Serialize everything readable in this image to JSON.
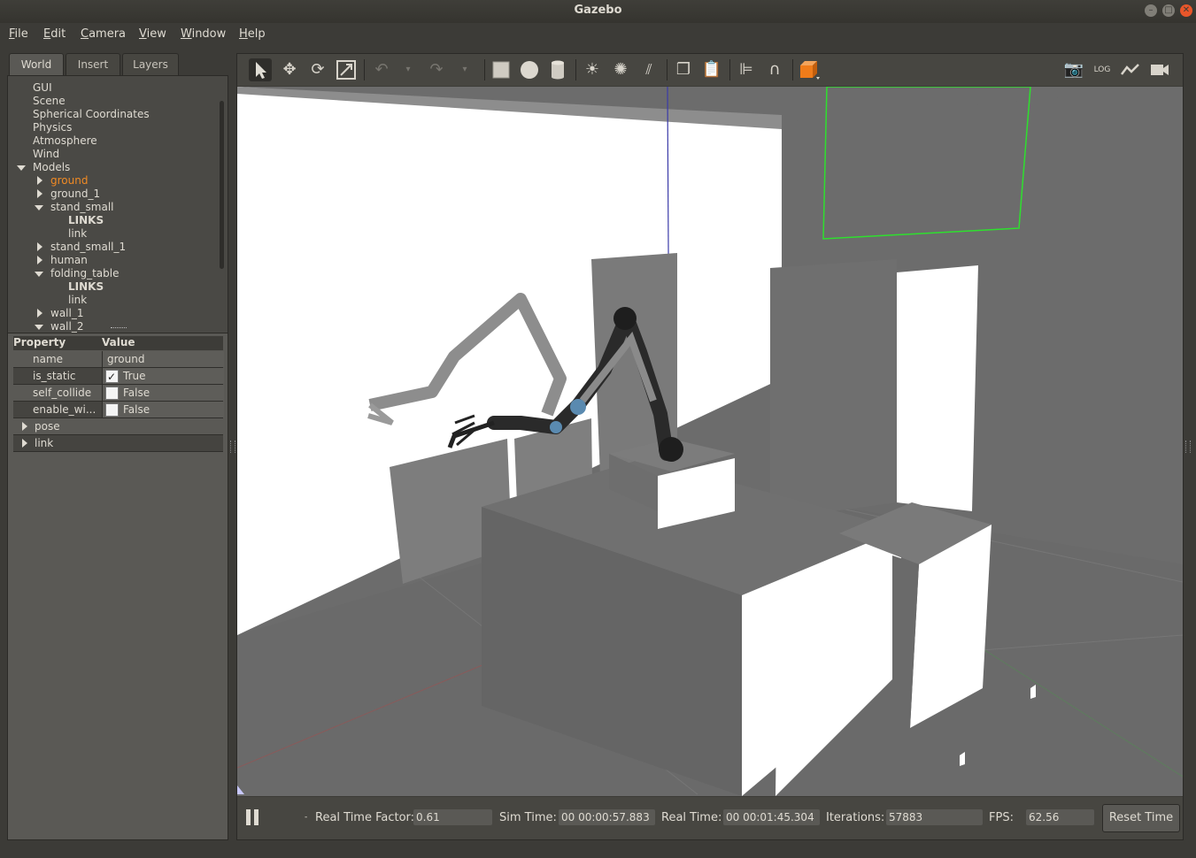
{
  "window": {
    "title": "Gazebo"
  },
  "menu": [
    "File",
    "Edit",
    "Camera",
    "View",
    "Window",
    "Help"
  ],
  "tabs": [
    "World",
    "Insert",
    "Layers"
  ],
  "tree": [
    {
      "label": "GUI",
      "indent": 0,
      "arrow": "none"
    },
    {
      "label": "Scene",
      "indent": 0,
      "arrow": "none"
    },
    {
      "label": "Spherical Coordinates",
      "indent": 0,
      "arrow": "none"
    },
    {
      "label": "Physics",
      "indent": 0,
      "arrow": "none"
    },
    {
      "label": "Atmosphere",
      "indent": 0,
      "arrow": "none"
    },
    {
      "label": "Wind",
      "indent": 0,
      "arrow": "none"
    },
    {
      "label": "Models",
      "indent": 0,
      "arrow": "down"
    },
    {
      "label": "ground",
      "indent": 1,
      "arrow": "right",
      "selected": true
    },
    {
      "label": "ground_1",
      "indent": 1,
      "arrow": "right"
    },
    {
      "label": "stand_small",
      "indent": 1,
      "arrow": "down"
    },
    {
      "label": "LINKS",
      "indent": 2,
      "arrow": "none",
      "bold": true
    },
    {
      "label": "link",
      "indent": 2,
      "arrow": "none"
    },
    {
      "label": "stand_small_1",
      "indent": 1,
      "arrow": "right"
    },
    {
      "label": "human",
      "indent": 1,
      "arrow": "right"
    },
    {
      "label": "folding_table",
      "indent": 1,
      "arrow": "down"
    },
    {
      "label": "LINKS",
      "indent": 2,
      "arrow": "none",
      "bold": true
    },
    {
      "label": "link",
      "indent": 2,
      "arrow": "none"
    },
    {
      "label": "wall_1",
      "indent": 1,
      "arrow": "right"
    },
    {
      "label": "wall_2",
      "indent": 1,
      "arrow": "down"
    }
  ],
  "properties": {
    "header": {
      "property": "Property",
      "value": "Value"
    },
    "rows": [
      {
        "key": "name",
        "value": "ground",
        "type": "text"
      },
      {
        "key": "is_static",
        "value": "True",
        "type": "checkbox",
        "checked": true
      },
      {
        "key": "self_collide",
        "value": "False",
        "type": "checkbox",
        "checked": false
      },
      {
        "key": "enable_wi...",
        "value": "False",
        "type": "checkbox",
        "checked": false
      },
      {
        "key": "pose",
        "value": "",
        "type": "group"
      },
      {
        "key": "link",
        "value": "",
        "type": "group"
      }
    ]
  },
  "toolbar": {
    "icons": [
      "select-icon",
      "translate-icon",
      "rotate-icon",
      "scale-icon",
      "undo-icon",
      "undo-dropdown-icon",
      "redo-icon",
      "redo-dropdown-icon",
      "box-icon",
      "sphere-icon",
      "cylinder-icon",
      "point-light-icon",
      "spot-light-icon",
      "directional-light-icon",
      "copy-icon",
      "paste-icon",
      "align-icon",
      "snap-icon",
      "view-angle-icon",
      "screenshot-icon",
      "log-icon",
      "plot-icon",
      "record-icon"
    ]
  },
  "status": {
    "real_time_factor_label": "Real Time Factor:",
    "real_time_factor": "0.61",
    "sim_time_label": "Sim Time:",
    "sim_time": "00 00:00:57.883",
    "real_time_label": "Real Time:",
    "real_time": "00 00:01:45.304",
    "iterations_label": "Iterations:",
    "iterations": "57883",
    "fps_label": "FPS:",
    "fps": "62.56",
    "reset_label": "Reset Time"
  }
}
